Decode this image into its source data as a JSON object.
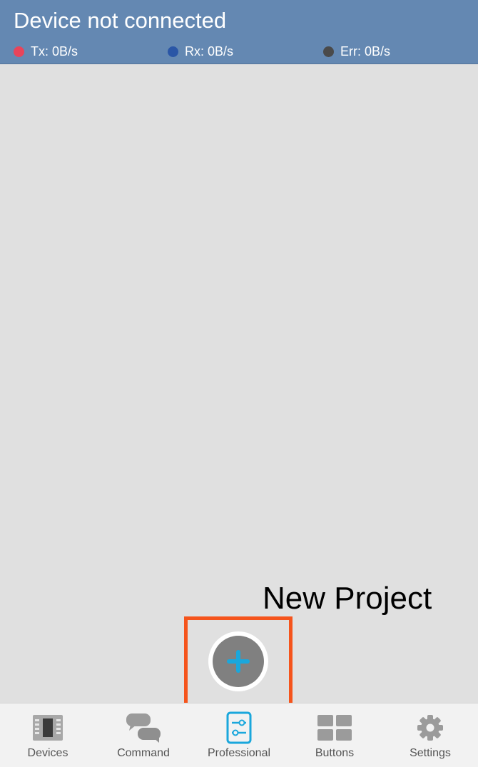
{
  "header": {
    "title": "Device not connected",
    "stats": {
      "tx": {
        "label": "Tx: 0B/s",
        "color": "#e8445a"
      },
      "rx": {
        "label": "Rx: 0B/s",
        "color": "#2a56a6"
      },
      "err": {
        "label": "Err: 0B/s",
        "color": "#4a4a4a"
      }
    },
    "background_color": "#6488b2"
  },
  "annotation": {
    "text": "New Project",
    "highlight_color": "#f5541c"
  },
  "fab": {
    "icon": "plus-icon",
    "icon_color": "#1aa7dc"
  },
  "bottom_nav": {
    "active": "Professional",
    "active_color": "#1aa7dc",
    "inactive_color": "#9b9b9b",
    "items": [
      {
        "label": "Devices",
        "icon": "device-chip-icon"
      },
      {
        "label": "Command",
        "icon": "chat-bubbles-icon"
      },
      {
        "label": "Professional",
        "icon": "sliders-icon"
      },
      {
        "label": "Buttons",
        "icon": "grid-buttons-icon"
      },
      {
        "label": "Settings",
        "icon": "gear-icon"
      }
    ]
  }
}
